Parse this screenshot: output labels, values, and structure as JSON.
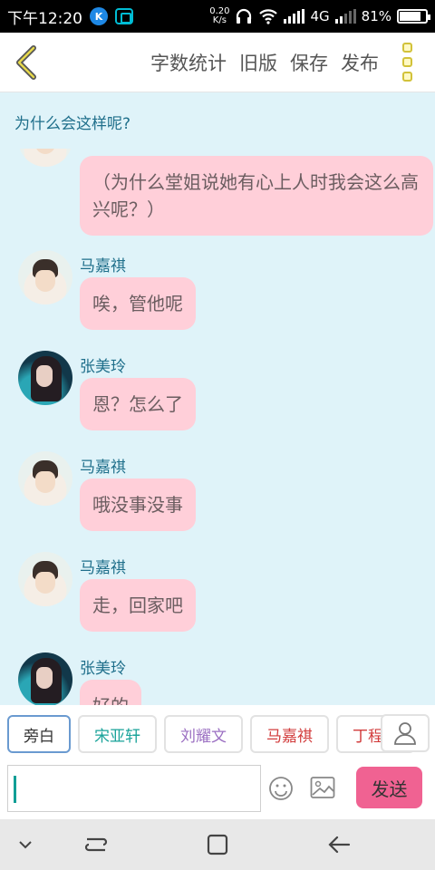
{
  "status_bar": {
    "time": "下午12:20",
    "net_speed_value": "0.20",
    "net_speed_unit": "K/s",
    "network_type": "4G",
    "battery": "81%",
    "battery_level": 0.81
  },
  "toolbar": {
    "actions": [
      "字数统计",
      "旧版",
      "保存",
      "发布"
    ]
  },
  "chat": {
    "title": "为什么会这样呢?",
    "messages": [
      {
        "sender": "",
        "avatar": "boy",
        "text": "（为什么堂姐说她有心上人时我会这么高兴呢？）"
      },
      {
        "sender": "马嘉祺",
        "avatar": "boy",
        "text": "唉，管他呢"
      },
      {
        "sender": "张美玲",
        "avatar": "girl",
        "text": "恩？怎么了"
      },
      {
        "sender": "马嘉祺",
        "avatar": "boy",
        "text": "哦没事没事"
      },
      {
        "sender": "马嘉祺",
        "avatar": "boy",
        "text": "走，回家吧"
      },
      {
        "sender": "张美玲",
        "avatar": "girl",
        "text": "好的"
      }
    ]
  },
  "roles": [
    {
      "label": "旁白",
      "color": "#333333"
    },
    {
      "label": "宋亚轩",
      "color": "#1aa39a"
    },
    {
      "label": "刘耀文",
      "color": "#9b6fc2"
    },
    {
      "label": "马嘉祺",
      "color": "#d23c3c"
    },
    {
      "label": "丁程鑫",
      "color": "#d23c3c"
    }
  ],
  "input": {
    "value": "",
    "send_label": "发送"
  }
}
